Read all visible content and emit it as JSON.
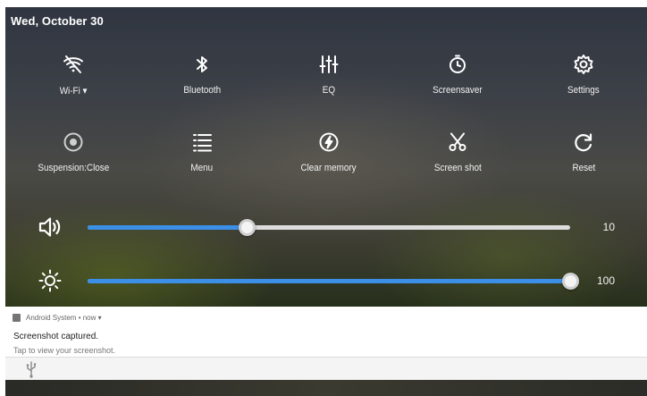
{
  "status": {
    "date": "Wed, October 30"
  },
  "tiles": [
    {
      "label": "Wi-Fi ▾",
      "icon": "wifi-off-icon"
    },
    {
      "label": "Bluetooth",
      "icon": "bluetooth-icon"
    },
    {
      "label": "EQ",
      "icon": "equalizer-icon"
    },
    {
      "label": "Screensaver",
      "icon": "timer-icon"
    },
    {
      "label": "Settings",
      "icon": "gear-icon"
    },
    {
      "label": "Suspension:Close",
      "icon": "radio-target-icon"
    },
    {
      "label": "Menu",
      "icon": "menu-list-icon"
    },
    {
      "label": "Clear memory",
      "icon": "bolt-circle-icon"
    },
    {
      "label": "Screen shot",
      "icon": "scissors-icon"
    },
    {
      "label": "Reset",
      "icon": "refresh-icon"
    }
  ],
  "sliders": {
    "volume": {
      "value": "10",
      "fraction": 0.33,
      "icon": "speaker-icon"
    },
    "brightness": {
      "value": "100",
      "fraction": 1.0,
      "icon": "sun-icon"
    }
  },
  "notification": {
    "header": "Android System • now ▾",
    "title": "Screenshot captured.",
    "text": "Tap to view your screenshot."
  },
  "colors": {
    "accent": "#3b8fe6",
    "track": "#dcdcdc"
  }
}
